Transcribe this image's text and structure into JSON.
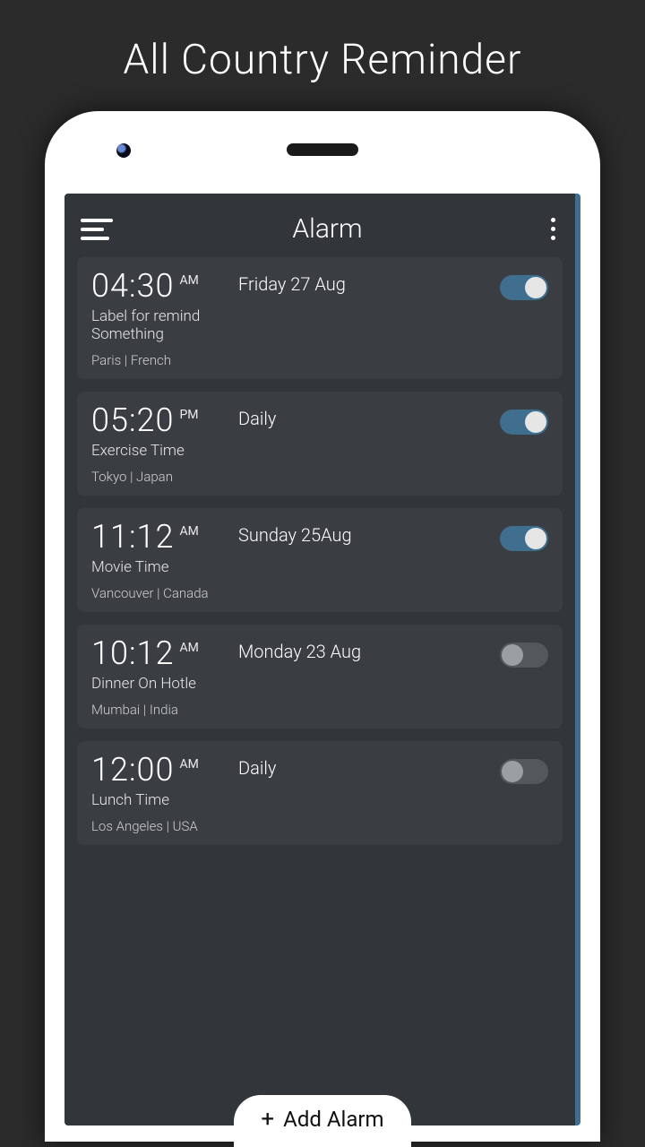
{
  "page": {
    "title": "All Country Reminder"
  },
  "appbar": {
    "title": "Alarm"
  },
  "alarms": [
    {
      "time": "04:30",
      "ampm": "AM",
      "schedule": "Friday 27 Aug",
      "label": "Label for remind Something",
      "location": "Paris | French",
      "enabled": true
    },
    {
      "time": "05:20",
      "ampm": "PM",
      "schedule": "Daily",
      "label": "Exercise Time",
      "location": "Tokyo | Japan",
      "enabled": true
    },
    {
      "time": "11:12",
      "ampm": "AM",
      "schedule": "Sunday 25Aug",
      "label": "Movie Time",
      "location": "Vancouver | Canada",
      "enabled": true
    },
    {
      "time": "10:12",
      "ampm": "AM",
      "schedule": "Monday 23 Aug",
      "label": "Dinner On Hotle",
      "location": "Mumbai | India",
      "enabled": false
    },
    {
      "time": "12:00",
      "ampm": "AM",
      "schedule": "Daily",
      "label": "Lunch Time",
      "location": "Los Angeles | USA",
      "enabled": false
    }
  ],
  "addButton": {
    "label": "Add Alarm"
  },
  "colors": {
    "accent": "#3f6e8f",
    "cardBg": "#3a3e43",
    "screenBg": "#32363b",
    "pageBg": "#2b2b2b"
  }
}
